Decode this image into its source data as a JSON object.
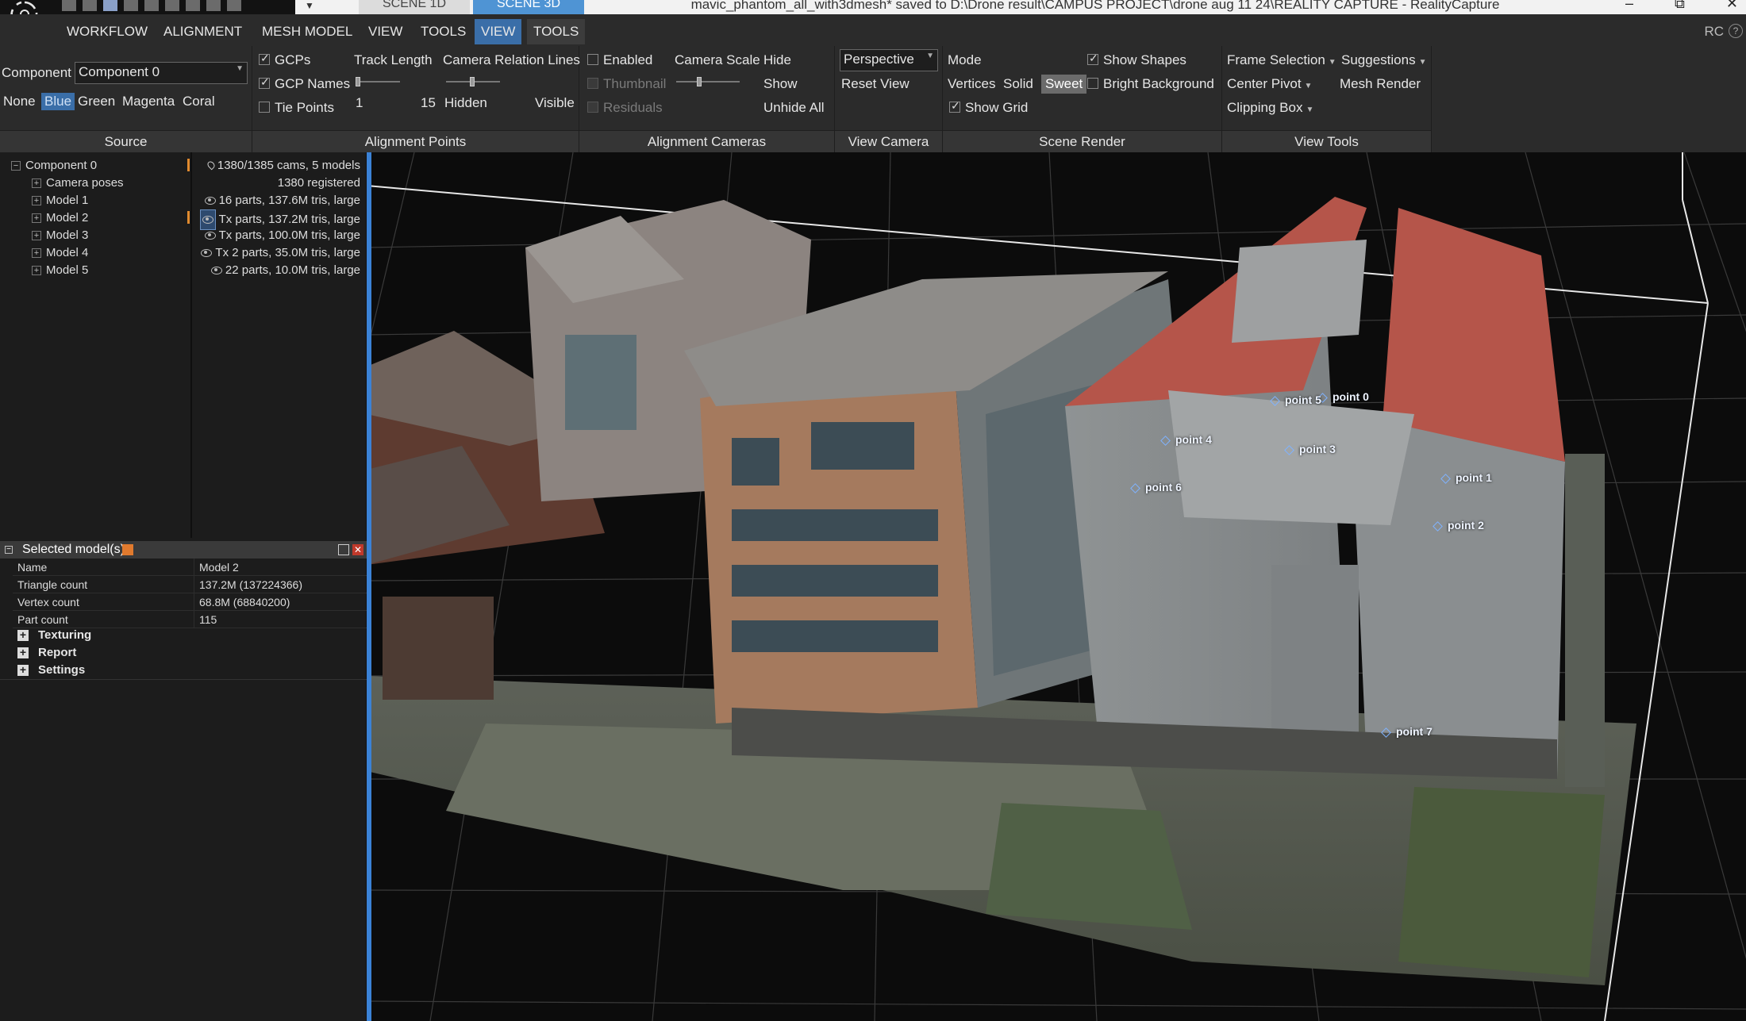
{
  "app": {
    "window_title": "mavic_phantom_all_with3dmesh* saved to D:\\Drone result\\CAMPUS PROJECT\\drone aug 11 24\\REALITY CAPTURE - RealityCapture",
    "scene_tabs": [
      "SCENE 1D",
      "SCENE 3D"
    ],
    "rc_label": "RC",
    "help": "?"
  },
  "window_controls": [
    "–",
    "⧉",
    "✕"
  ],
  "menu": {
    "items": [
      "WORKFLOW",
      "ALIGNMENT",
      "MESH MODEL",
      "VIEW",
      "TOOLS"
    ],
    "active": "VIEW",
    "context": "TOOLS"
  },
  "ribbon": {
    "source": {
      "label": "Source",
      "component_label": "Component",
      "component_value": "Component 0",
      "colors": [
        "None",
        "Blue",
        "Green",
        "Magenta",
        "Coral"
      ],
      "selected_color": "Blue"
    },
    "alignment_points": {
      "label": "Alignment Points",
      "gcps": "GCPs",
      "gcp_names": "GCP Names",
      "tie_points": "Tie Points",
      "track_length": "Track Length",
      "track_min": "1",
      "track_max": "15",
      "relation_lines": "Camera Relation Lines",
      "hidden": "Hidden",
      "visible": "Visible",
      "gcps_checked": true,
      "gcp_names_checked": true,
      "tie_points_checked": false
    },
    "alignment_cameras": {
      "label": "Alignment Cameras",
      "enabled": "Enabled",
      "thumbnail": "Thumbnail",
      "residuals": "Residuals",
      "camera_scale": "Camera Scale",
      "hide": "Hide",
      "show": "Show",
      "unhide_all": "Unhide All"
    },
    "view_camera": {
      "label": "View Camera",
      "projection": "Perspective",
      "reset": "Reset View"
    },
    "scene_render": {
      "label": "Scene Render",
      "mode": "Mode",
      "modes": [
        "Vertices",
        "Solid",
        "Sweet"
      ],
      "active_mode": "Sweet",
      "show_grid": "Show Grid",
      "show_shapes": "Show Shapes",
      "bright_background": "Bright Background",
      "show_grid_checked": true,
      "show_shapes_checked": true,
      "bright_background_checked": false
    },
    "view_tools": {
      "label": "View Tools",
      "frame_selection": "Frame Selection",
      "center_pivot": "Center Pivot",
      "clipping_box": "Clipping Box",
      "suggestions": "Suggestions",
      "mesh_render": "Mesh Render"
    }
  },
  "tree": {
    "items": [
      {
        "label": "Component 0",
        "info": "1380/1385 cams, 5 models"
      },
      {
        "label": "Camera poses",
        "info": "1380 registered"
      },
      {
        "label": "Model 1",
        "info": "16 parts, 137.6M tris, large"
      },
      {
        "label": "Model 2",
        "info": "Tx parts, 137.2M tris, large"
      },
      {
        "label": "Model 3",
        "info": "Tx parts, 100.0M tris, large"
      },
      {
        "label": "Model 4",
        "info": "Tx 2 parts, 35.0M tris, large"
      },
      {
        "label": "Model 5",
        "info": "22 parts, 10.0M tris, large"
      }
    ]
  },
  "properties": {
    "title": "Selected model(s)",
    "rows": [
      {
        "key": "Name",
        "value": "Model 2"
      },
      {
        "key": "Triangle count",
        "value": "137.2M (137224366)"
      },
      {
        "key": "Vertex count",
        "value": "68.8M (68840200)"
      },
      {
        "key": "Part count",
        "value": "115"
      }
    ],
    "sections": [
      "Texturing",
      "Report",
      "Settings"
    ]
  },
  "viewport": {
    "gcp_points": [
      {
        "label": "point 0"
      },
      {
        "label": "point 1"
      },
      {
        "label": "point 2"
      },
      {
        "label": "point 3"
      },
      {
        "label": "point 4"
      },
      {
        "label": "point 5"
      },
      {
        "label": "point 6"
      },
      {
        "label": "point 7"
      }
    ],
    "colors": {
      "grid": "#3a3a3a",
      "accent": "#3b82d6",
      "roof_red": "#b5554a"
    }
  }
}
